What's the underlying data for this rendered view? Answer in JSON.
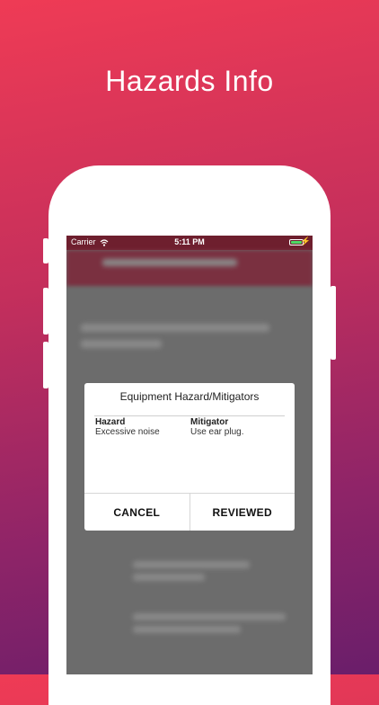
{
  "headline": "Hazards Info",
  "status_bar": {
    "carrier": "Carrier",
    "time": "5:11 PM"
  },
  "dialog": {
    "title": "Equipment Hazard/Mitigators",
    "columns": [
      {
        "header": "Hazard",
        "value": "Excessive noise"
      },
      {
        "header": "Mitigator",
        "value": "Use ear plug."
      }
    ],
    "cancel_label": "CANCEL",
    "reviewed_label": "REVIEWED"
  },
  "colors": {
    "gradient_top": "#ef3b55",
    "gradient_bottom": "#6a1e6a",
    "status_bar": "#6e1f2e",
    "battery": "#4cd964"
  }
}
